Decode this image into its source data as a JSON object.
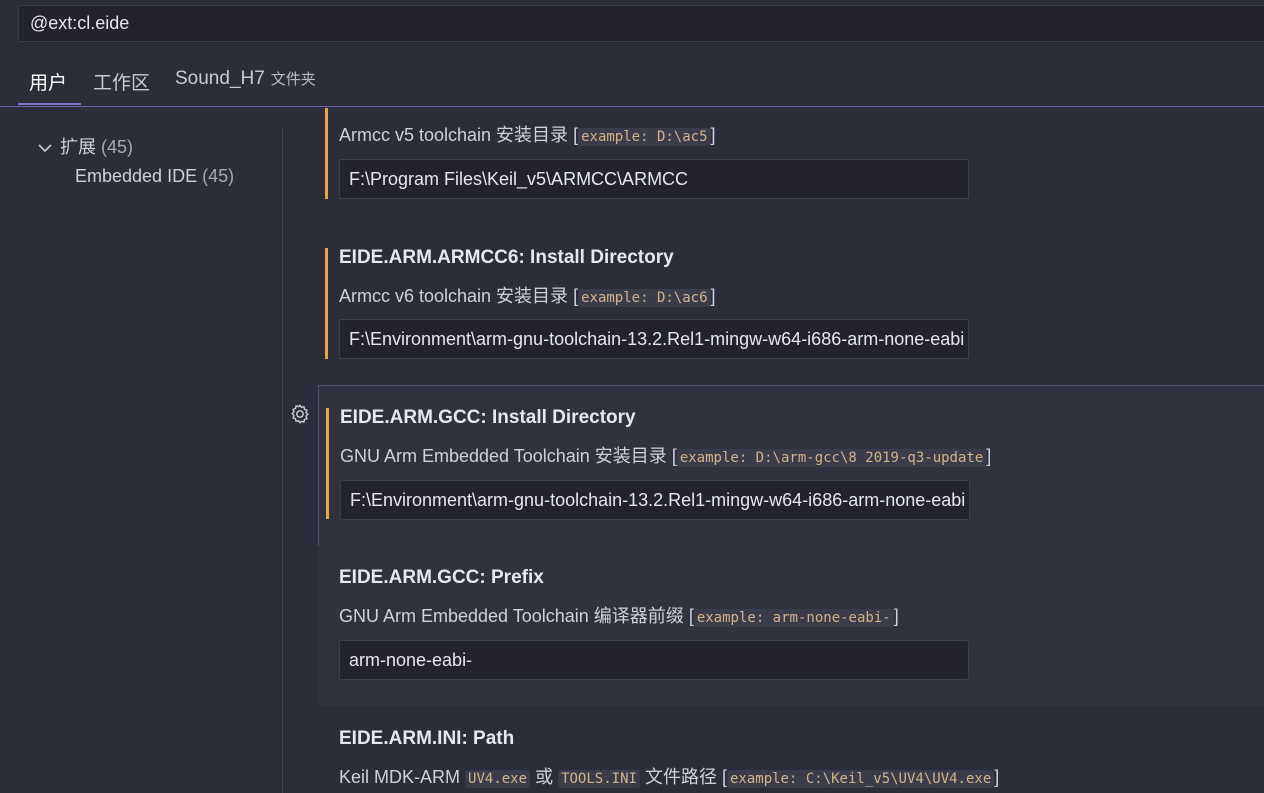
{
  "search": {
    "value": "@ext:cl.eide"
  },
  "tabs": [
    {
      "label": "用户"
    },
    {
      "label": "工作区"
    },
    {
      "label": "Sound_H7",
      "sub": "文件夹"
    }
  ],
  "toc": {
    "group": {
      "label": "扩展",
      "count": "(45)"
    },
    "child": {
      "label": "Embedded IDE",
      "count": "(45)"
    }
  },
  "settings": [
    {
      "desc_text": "Armcc v5 toolchain 安装目录",
      "desc_code": "example: D:\\ac5",
      "value": "F:\\Program Files\\Keil_v5\\ARMCC\\ARMCC"
    },
    {
      "title": "EIDE.ARM.ARMCC6: Install Directory",
      "desc_text": "Armcc v6 toolchain 安装目录",
      "desc_code": "example: D:\\ac6",
      "value": "F:\\Environment\\arm-gnu-toolchain-13.2.Rel1-mingw-w64-i686-arm-none-eabi"
    },
    {
      "title": "EIDE.ARM.GCC: Install Directory",
      "desc_text": "GNU Arm Embedded Toolchain 安装目录",
      "desc_code": "example: D:\\arm-gcc\\8 2019-q3-update",
      "value": "F:\\Environment\\arm-gnu-toolchain-13.2.Rel1-mingw-w64-i686-arm-none-eabi"
    },
    {
      "title": "EIDE.ARM.GCC: Prefix",
      "desc_text": "GNU Arm Embedded Toolchain 编译器前缀",
      "desc_code": "example: arm-none-eabi-",
      "value": "arm-none-eabi-"
    },
    {
      "title": "EIDE.ARM.INI: Path",
      "desc_pre": "Keil MDK-ARM",
      "desc_code1": "UV4.exe",
      "desc_or": "或",
      "desc_code2": "TOOLS.INI",
      "desc_post": "文件路径",
      "desc_code": "example: C:\\Keil_v5\\UV4\\UV4.exe"
    }
  ],
  "colors": {
    "accent": "#7f70c9",
    "modified": "#e5a54b",
    "code": "#d3b48a"
  },
  "icons": {
    "toc_expand": "chevron-down-icon",
    "setting_menu": "gear-icon"
  }
}
